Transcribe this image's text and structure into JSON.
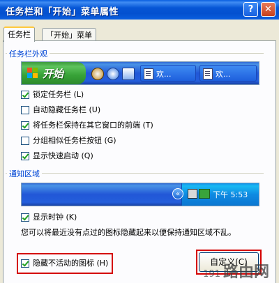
{
  "window": {
    "title": "任务栏和「开始」菜单属性"
  },
  "titlebar": {
    "help_label": "?",
    "close_label": "✕"
  },
  "tabs": [
    {
      "label": "任务栏",
      "active": true
    },
    {
      "label": "「开始」菜单",
      "active": false
    }
  ],
  "taskbar_appearance": {
    "group_title": "任务栏外观",
    "preview": {
      "start_label": "开始",
      "task_buttons": [
        "欢...",
        "欢..."
      ]
    },
    "options": [
      {
        "label": "锁定任务栏 (L)",
        "checked": true
      },
      {
        "label": "自动隐藏任务栏 (U)",
        "checked": false
      },
      {
        "label": "将任务栏保持在其它窗口的前端 (T)",
        "checked": true
      },
      {
        "label": "分组相似任务栏按钮 (G)",
        "checked": false
      },
      {
        "label": "显示快速启动 (Q)",
        "checked": true
      }
    ]
  },
  "notification_area": {
    "group_title": "通知区域",
    "preview": {
      "clock": "下午 5:53",
      "chevron": "«"
    },
    "show_clock": {
      "label": "显示时钟 (K)",
      "checked": true
    },
    "description": "您可以将最近没有点过的图标隐藏起来以便保持通知区域不乱。",
    "hide_inactive": {
      "label": "隐藏不活动的图标 (H)",
      "checked": true
    }
  },
  "buttons": {
    "customize_label": "自定义(C)"
  },
  "watermark": {
    "prefix": "191",
    "text": "路由网"
  },
  "colors": {
    "highlight": "#d40000",
    "xp_blue": "#0a5fe0",
    "start_green": "#3c9a3c"
  }
}
